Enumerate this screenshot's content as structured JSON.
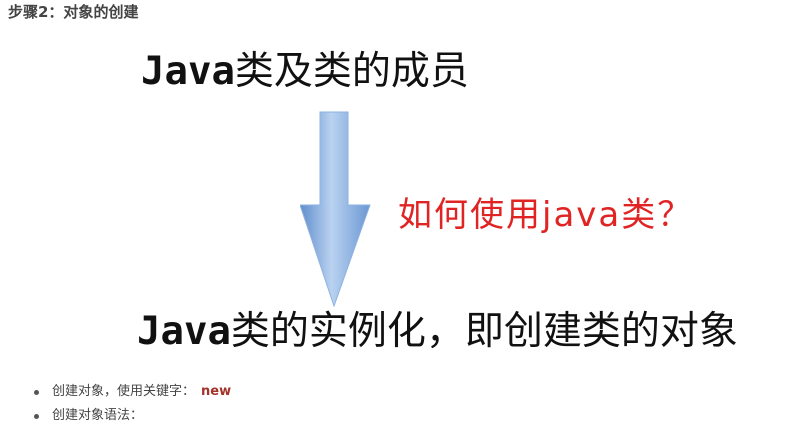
{
  "step_title": "步骤2：对象的创建",
  "top_heading": {
    "code": "Java",
    "text": "类及类的成员"
  },
  "bottom_heading": {
    "code": "Java",
    "text": "类的实例化，即创建类的对象"
  },
  "question": "如何使用java类？",
  "bullets": [
    {
      "text": "创建对象，使用关键字：",
      "keyword": "new"
    },
    {
      "text": "创建对象语法："
    }
  ],
  "colors": {
    "arrow": "#7ea6dc",
    "question": "#e02424",
    "keyword": "#a3322b"
  }
}
